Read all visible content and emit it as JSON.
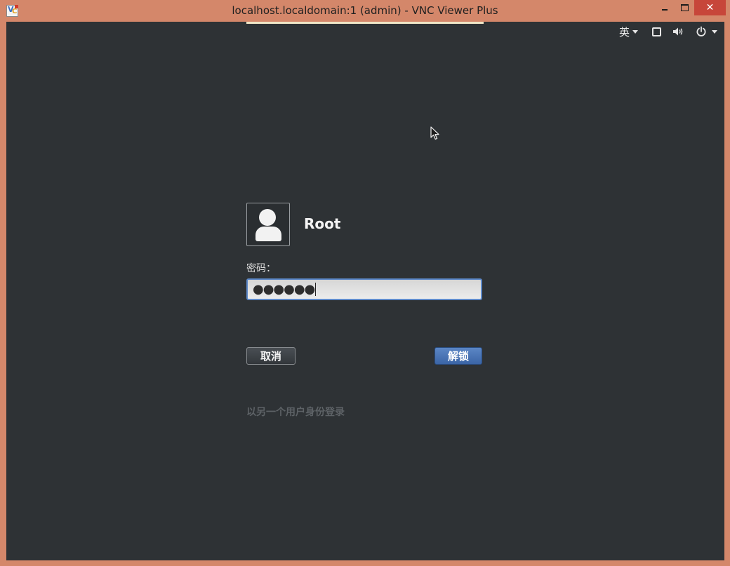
{
  "window": {
    "title": "localhost.localdomain:1 (admin) - VNC Viewer Plus",
    "icon": "vnc-viewer-app-icon",
    "controls": {
      "minimize": "minimize-icon",
      "maximize": "maximize-icon",
      "close": "close-icon"
    }
  },
  "panel": {
    "input_method": "英",
    "indicators": [
      "display-icon",
      "volume-icon",
      "power-icon"
    ]
  },
  "login": {
    "username": "Root",
    "password_label": "密码：",
    "password_masked": "●●●●●●",
    "cancel_label": "取消",
    "unlock_label": "解锁",
    "switch_user_label": "以另一个用户身份登录"
  },
  "colors": {
    "window_frame": "#d4876a",
    "desktop_bg": "#2e3235",
    "close_button": "#c7463a",
    "unlock_button": "#4a74b5",
    "field_focus_border": "#5d89c9"
  }
}
